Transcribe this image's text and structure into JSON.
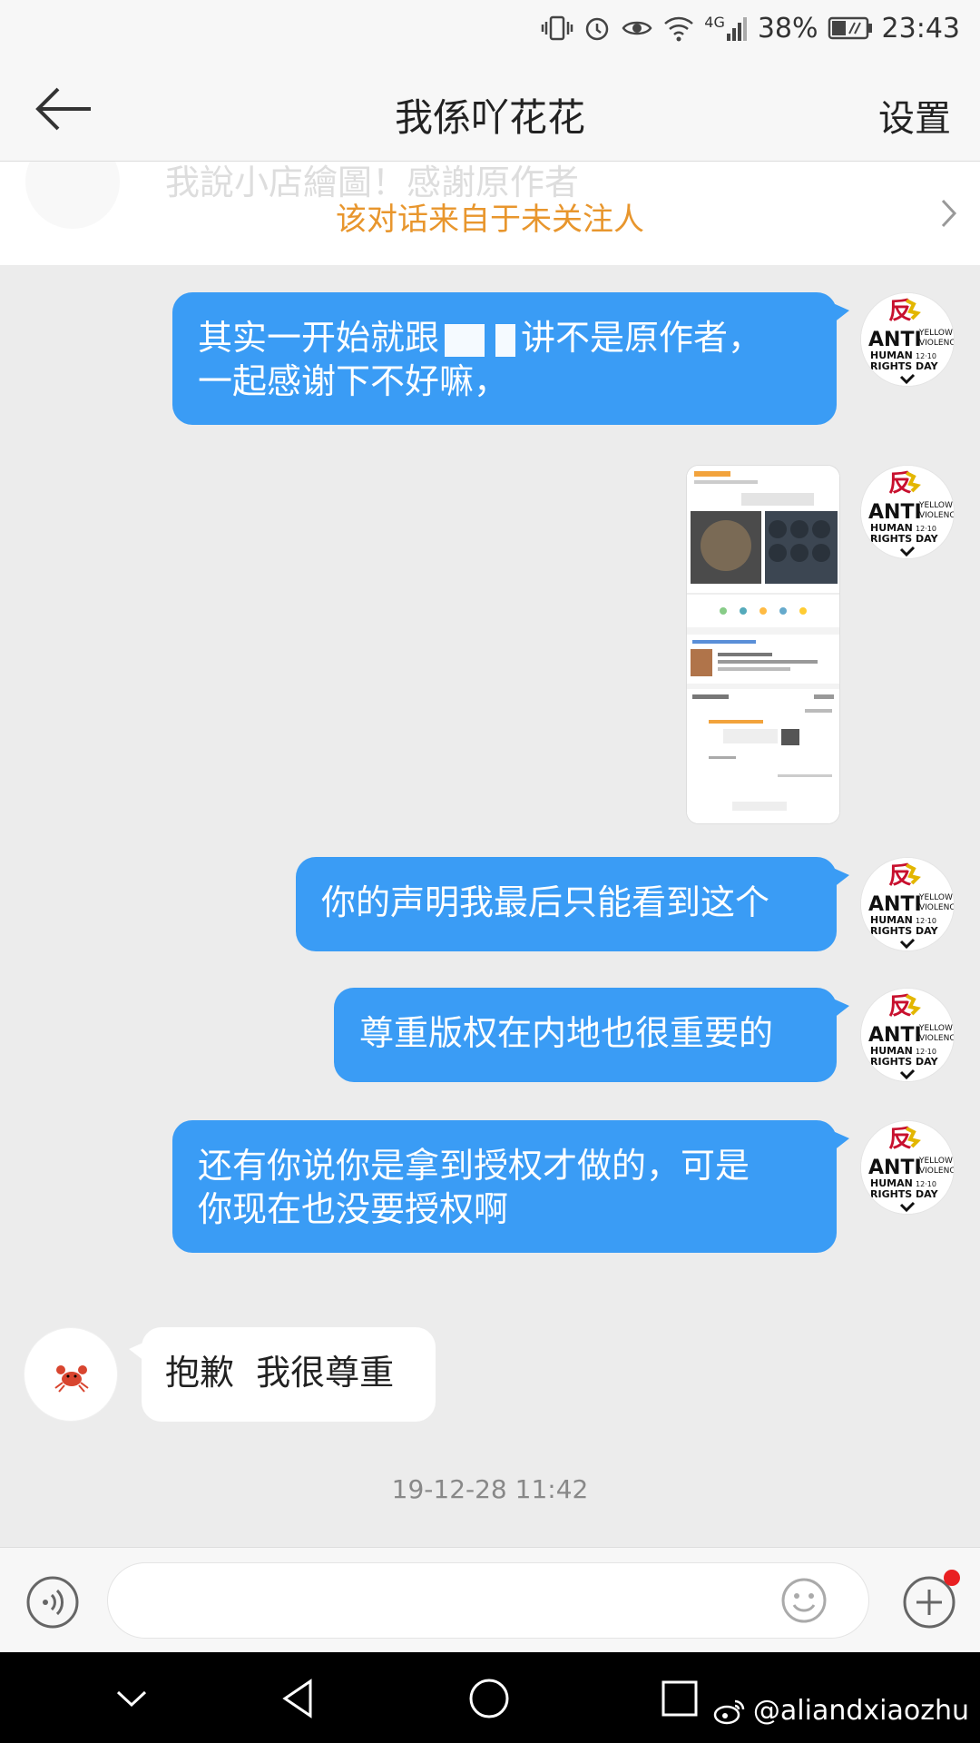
{
  "status_bar": {
    "battery": "38%",
    "time": "23:43",
    "network": "4G",
    "icons": [
      "vibrate-icon",
      "alarm-icon",
      "eye-icon",
      "wifi-icon",
      "signal-icon",
      "battery-icon"
    ]
  },
  "header": {
    "title": "我係吖花花",
    "settings_label": "设置"
  },
  "notice": {
    "ghost_text": "我說小店繪圖！感謝原作者",
    "text": "该对话来自于未关注人"
  },
  "avatar_badge": {
    "big": "ANTI",
    "line1": "HUMAN",
    "line2": "RIGHTS DAY",
    "side1": "YELLOW",
    "side2": "VIOLENCE",
    "date": "12·10",
    "char": "反"
  },
  "messages": [
    {
      "from": "me",
      "part1": "其实一开始就跟",
      "part2": "讲不是原作者，",
      "line2": "一起感谢下不好嘛，"
    },
    {
      "from": "me",
      "type": "image"
    },
    {
      "from": "me",
      "text": "你的声明我最后只能看到这个"
    },
    {
      "from": "me",
      "text": "尊重版权在内地也很重要的"
    },
    {
      "from": "me",
      "line1": "还有你说你是拿到授权才做的，可是",
      "line2": "你现在也没要授权啊"
    },
    {
      "from": "other",
      "text": "抱歉  我很尊重"
    }
  ],
  "timestamp": "19-12-28 11:42",
  "input": {
    "placeholder": ""
  },
  "watermark": "@aliandxiaozhu",
  "colors": {
    "bubble_out": "#3a9cf5",
    "notice": "#e8962d",
    "badge_dot": "#e92022"
  }
}
